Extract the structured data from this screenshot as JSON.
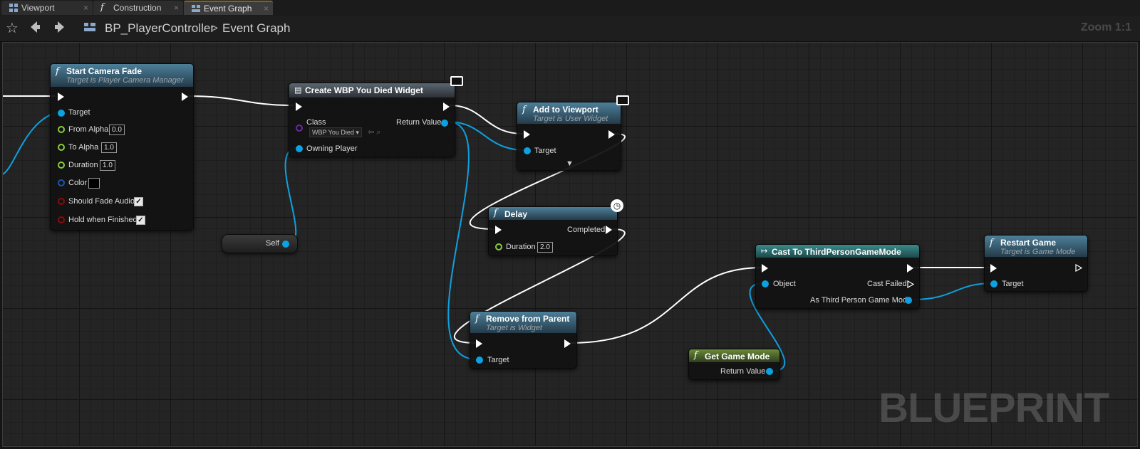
{
  "tabs": [
    {
      "label": "Viewport",
      "icon": "viewport-icon"
    },
    {
      "label": "Construction Scrip",
      "icon": "function-icon"
    },
    {
      "label": "Event Graph",
      "icon": "event-graph-icon",
      "active": true
    }
  ],
  "toolbar": {
    "blueprint_name": "BP_PlayerController",
    "separator": ">",
    "graph_name": "Event Graph",
    "zoom": "Zoom 1:1"
  },
  "watermark": "BLUEPRINT",
  "colors": {
    "exec": "#ffffff",
    "object_pin": "#0fa0e0",
    "float_pin": "#8acc3a",
    "bool_pin": "#8a0b0b",
    "color_pin": "#1a55b0",
    "class_pin": "#6a2aa0",
    "header_function": "#3a5a6e",
    "header_cast": "#2a6a6a",
    "header_pure": "#4d6a2e"
  },
  "nodes": {
    "start_camera_fade": {
      "title": "Start Camera Fade",
      "subtitle": "Target is Player Camera Manager",
      "pins": {
        "target": "Target",
        "from_alpha": "From Alpha",
        "from_alpha_value": "0.0",
        "to_alpha": "To Alpha",
        "to_alpha_value": "1.0",
        "duration": "Duration",
        "duration_value": "1.0",
        "color": "Color",
        "should_fade_audio": "Should Fade Audio",
        "hold_when_finished": "Hold when Finished"
      }
    },
    "create_widget": {
      "title": "Create WBP You Died Widget",
      "pins": {
        "class": "Class",
        "class_value": "WBP You Died",
        "return_value": "Return Value",
        "owning_player": "Owning Player"
      }
    },
    "self": {
      "label": "Self"
    },
    "add_to_viewport": {
      "title": "Add to Viewport",
      "subtitle": "Target is User Widget",
      "pins": {
        "target": "Target"
      }
    },
    "delay": {
      "title": "Delay",
      "pins": {
        "completed": "Completed",
        "duration": "Duration",
        "duration_value": "2.0"
      }
    },
    "remove_from_parent": {
      "title": "Remove from Parent",
      "subtitle": "Target is Widget",
      "pins": {
        "target": "Target"
      }
    },
    "cast": {
      "title": "Cast To ThirdPersonGameMode",
      "pins": {
        "object": "Object",
        "cast_failed": "Cast Failed",
        "as_game_mode": "As Third Person Game Mode"
      }
    },
    "get_game_mode": {
      "title": "Get Game Mode",
      "pins": {
        "return_value": "Return Value"
      }
    },
    "restart_game": {
      "title": "Restart Game",
      "subtitle": "Target is Game Mode",
      "pins": {
        "target": "Target"
      }
    }
  }
}
